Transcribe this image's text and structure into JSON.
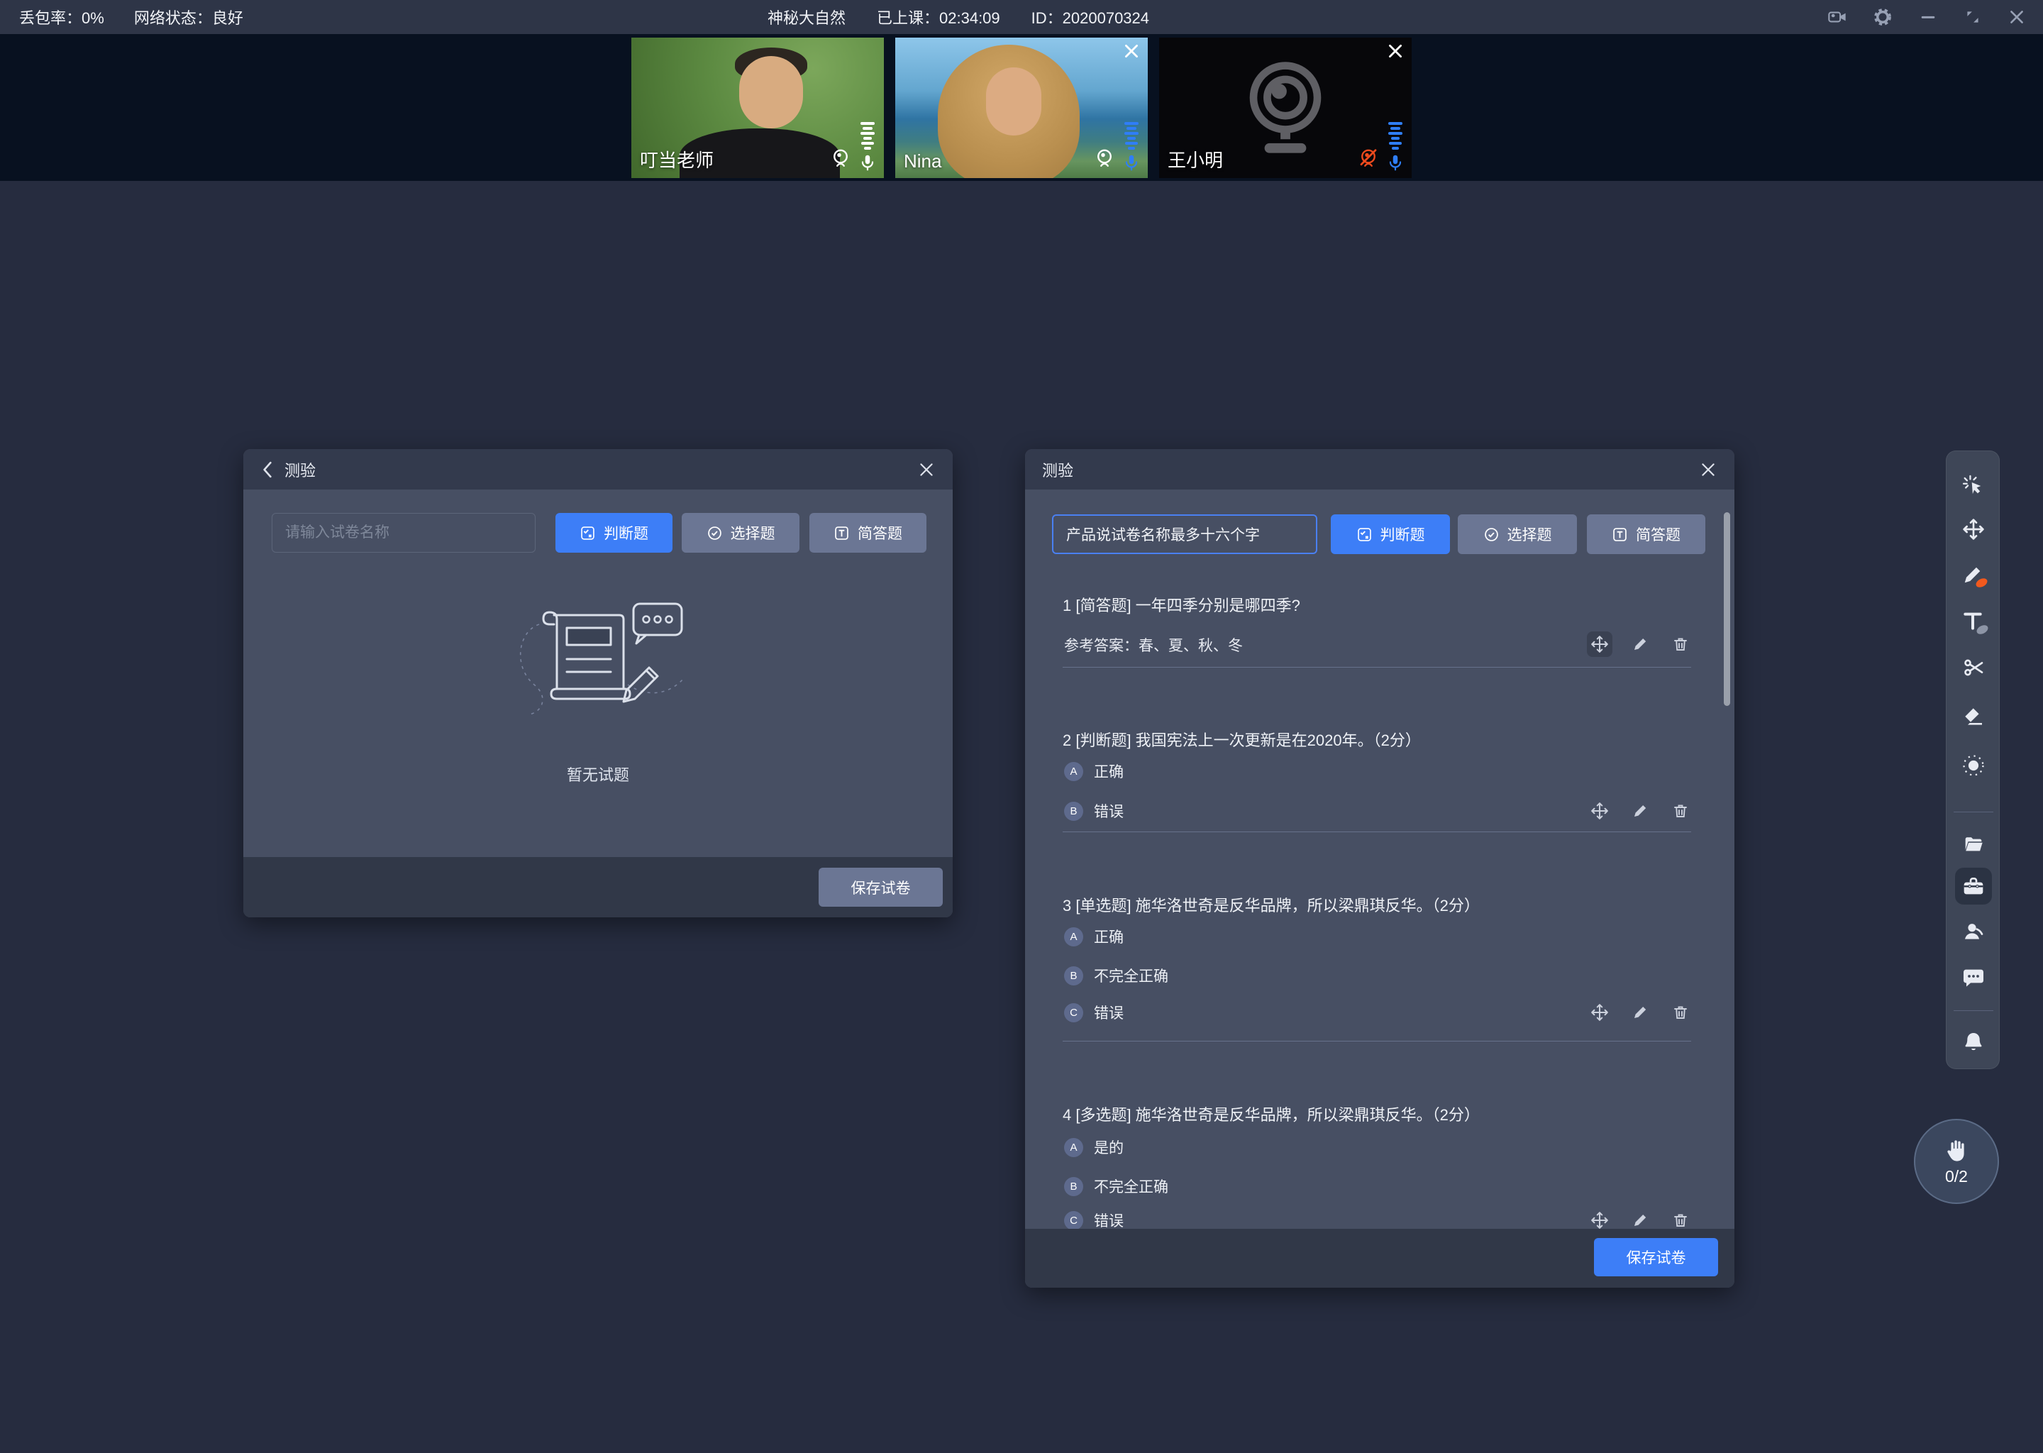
{
  "top_bar": {
    "packet_loss": "丢包率：0%",
    "network_status": "网络状态：良好",
    "room_title": "神秘大自然",
    "class_time": "已上课：02:34:09",
    "room_id": "ID：2020070324"
  },
  "videos": [
    {
      "name": "叮当老师",
      "camera": "on",
      "mic": "on",
      "closable": false
    },
    {
      "name": "Nina",
      "camera": "on",
      "mic": "on",
      "closable": true
    },
    {
      "name": "王小明",
      "camera": "off",
      "mic": "on",
      "closable": true
    }
  ],
  "left_panel": {
    "title": "测验",
    "input_placeholder": "请输入试卷名称",
    "type_buttons": [
      "判断题",
      "选择题",
      "简答题"
    ],
    "empty_text": "暂无试题",
    "save_label": "保存试卷"
  },
  "right_panel": {
    "title": "测验",
    "input_value": "产品说试卷名称最多十六个字",
    "type_buttons": [
      "判断题",
      "选择题",
      "简答题"
    ],
    "save_label": "保存试卷",
    "questions": [
      {
        "label": "1 [简答题] 一年四季分别是哪四季?",
        "answer": "参考答案：春、夏、秋、冬",
        "options": []
      },
      {
        "label": "2 [判断题] 我国宪法上一次更新是在2020年。（2分）",
        "options": [
          {
            "key": "A",
            "text": "正确"
          },
          {
            "key": "B",
            "text": "错误"
          }
        ]
      },
      {
        "label": "3 [单选题] 施华洛世奇是反华品牌，所以梁鼎琪反华。（2分）",
        "options": [
          {
            "key": "A",
            "text": "正确"
          },
          {
            "key": "B",
            "text": "不完全正确"
          },
          {
            "key": "C",
            "text": "错误"
          }
        ]
      },
      {
        "label": "4 [多选题] 施华洛世奇是反华品牌，所以梁鼎琪反华。（2分）",
        "options": [
          {
            "key": "A",
            "text": "是的"
          },
          {
            "key": "B",
            "text": "不完全正确"
          },
          {
            "key": "C",
            "text": "错误"
          }
        ]
      }
    ]
  },
  "hand_raise": {
    "count": "0/2"
  },
  "colors": {
    "accent_blue": "#3d7ef7",
    "pen_indicator_orange": "#f2591d",
    "mic_blue": "#2f7ef8",
    "camera_off_red": "#ee4a1d"
  }
}
